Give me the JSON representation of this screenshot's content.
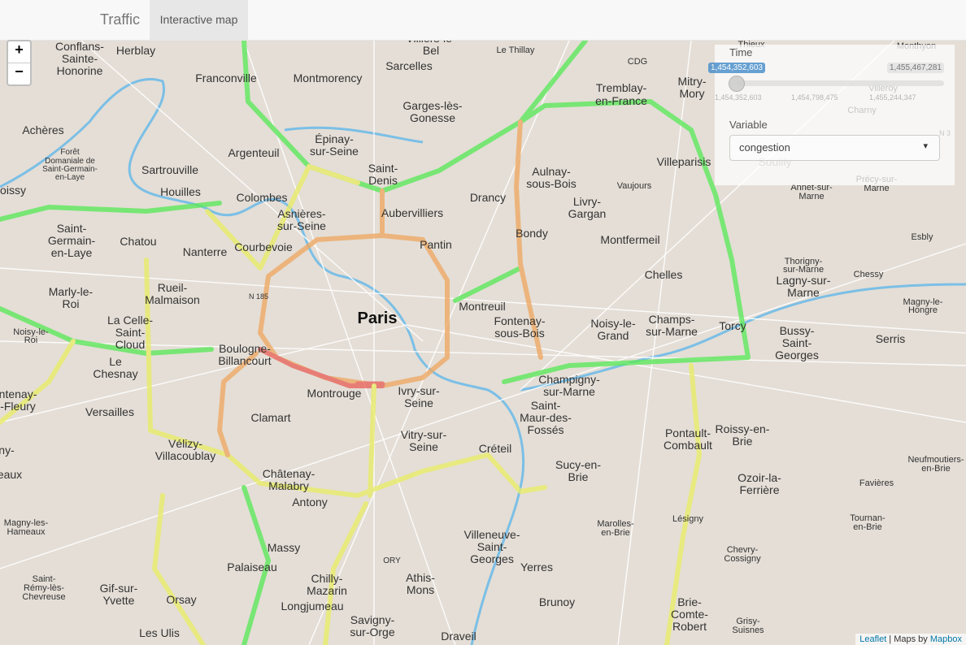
{
  "navbar": {
    "brand": "Traffic",
    "tab_label": "Interactive map"
  },
  "zoom": {
    "in_label": "+",
    "out_label": "−"
  },
  "controls": {
    "time_label": "Time",
    "time_min": "1,454,352,603",
    "time_max": "1,455,467,281",
    "time_value_fraction": 0,
    "time_ticks": [
      "1,454,352,603",
      "1,454,798,475",
      "1,455,244,347"
    ],
    "variable_label": "Variable",
    "variable_value": "congestion",
    "variable_caret": "▾"
  },
  "attribution": {
    "leaflet": "Leaflet",
    "separator": " | Maps by ",
    "mapbox": "Mapbox"
  },
  "place_labels": [
    "Conflans-",
    "Sainte-",
    "Honorine",
    "Herblay",
    "Franconville",
    "Montmorency",
    "Sarcelles",
    "Villiers-le-",
    "Bel",
    "Le Thillay",
    "CDG",
    "Thieux",
    "Monthyon",
    "Tremblay-",
    "en-France",
    "Mitry-",
    "Mory",
    "Garges-lès-",
    "Gonesse",
    "Achères",
    "Forêt",
    "Domaniale de",
    "Saint-Germain-",
    "en-Laye",
    "Argenteuil",
    "Épinay-",
    "sur-Seine",
    "Sartrouville",
    "oissy",
    "Houilles",
    "Colombes",
    "Asnières-",
    "sur-Seine",
    "Saint-",
    "Denis",
    "Aubervilliers",
    "Drancy",
    "Aulnay-",
    "sous-Bois",
    "Livry-",
    "Gargan",
    "Vaujours",
    "Villeparisis",
    "Saint-",
    "Germain-",
    "en-Laye",
    "Chatou",
    "Nanterre",
    "Courbevoie",
    "Pantin",
    "Bondy",
    "Montfermeil",
    "Annet-sur-",
    "Marne",
    "Précy-sur-",
    "Marne",
    "Marly-le-",
    "Roi",
    "Rueil-",
    "Malmaison",
    "N 185",
    "Paris",
    "Montreuil",
    "Fontenay-",
    "sous-Bois",
    "Chelles",
    "Thorigny-",
    "sur-Marne",
    "Lagny-sur-",
    "Marne",
    "Chessy",
    "Esbly",
    "Magny-le-",
    "Hongre",
    "Noisy-le-",
    "Roi",
    "La Celle-",
    "Saint-",
    "Cloud",
    "Boulogne-",
    "Billancourt",
    "Le",
    "Chesnay",
    "Noisy-le-",
    "Grand",
    "Champs-",
    "sur-Marne",
    "Torcy",
    "Bussy-",
    "Saint-",
    "Georges",
    "Serris",
    "ntenay-",
    "-Fleury",
    "Versailles",
    "Montrouge",
    "Ivry-sur-",
    "Seine",
    "Champigny-",
    "sur-Marne",
    "Saint-",
    "Maur-des-",
    "Fossés",
    "Clamart",
    "Vitry-sur-",
    "Seine",
    "Créteil",
    "Sucy-en-",
    "Brie",
    "Pontault-",
    "Combault",
    "Roissy-en-",
    "Brie",
    "ny-",
    "eaux",
    "Vélizy-",
    "Villacoublay",
    "Châtenay-",
    "Malabry",
    "Antony",
    "Ozoir-la-",
    "Ferrière",
    "Neufmoutiers-",
    "en-Brie",
    "Favières",
    "Magny-les-",
    "Hameaux",
    "Massy",
    "Villeneuve-",
    "Saint-",
    "Georges",
    "Marolles-",
    "en-Brie",
    "Tournan-",
    "en-Brie",
    "Lésigny",
    "Palaiseau",
    "Chilly-",
    "Mazarin",
    "Longjumeau",
    "Chevry-",
    "Cossigny",
    "Saint-",
    "Rémy-lès-",
    "Chevreuse",
    "Gif-sur-",
    "Yvette",
    "Orsay",
    "Athis-",
    "Mons",
    "Yerres",
    "Brunoy",
    "Brie-",
    "Comte-",
    "Robert",
    "Grisy-",
    "Suisnes",
    "Les Ulis",
    "Savigny-",
    "sur-Orge",
    "Draveil",
    "ORY",
    "Villeroy",
    "Charny",
    "Soullly",
    "N 3"
  ],
  "colors": {
    "green": "#5ee85c",
    "yellow": "#e8ec6a",
    "orange": "#eeaa66",
    "red": "#e8675e",
    "water": "#7bbfe6",
    "road": "#ffffff",
    "land": "#e4ded6"
  }
}
